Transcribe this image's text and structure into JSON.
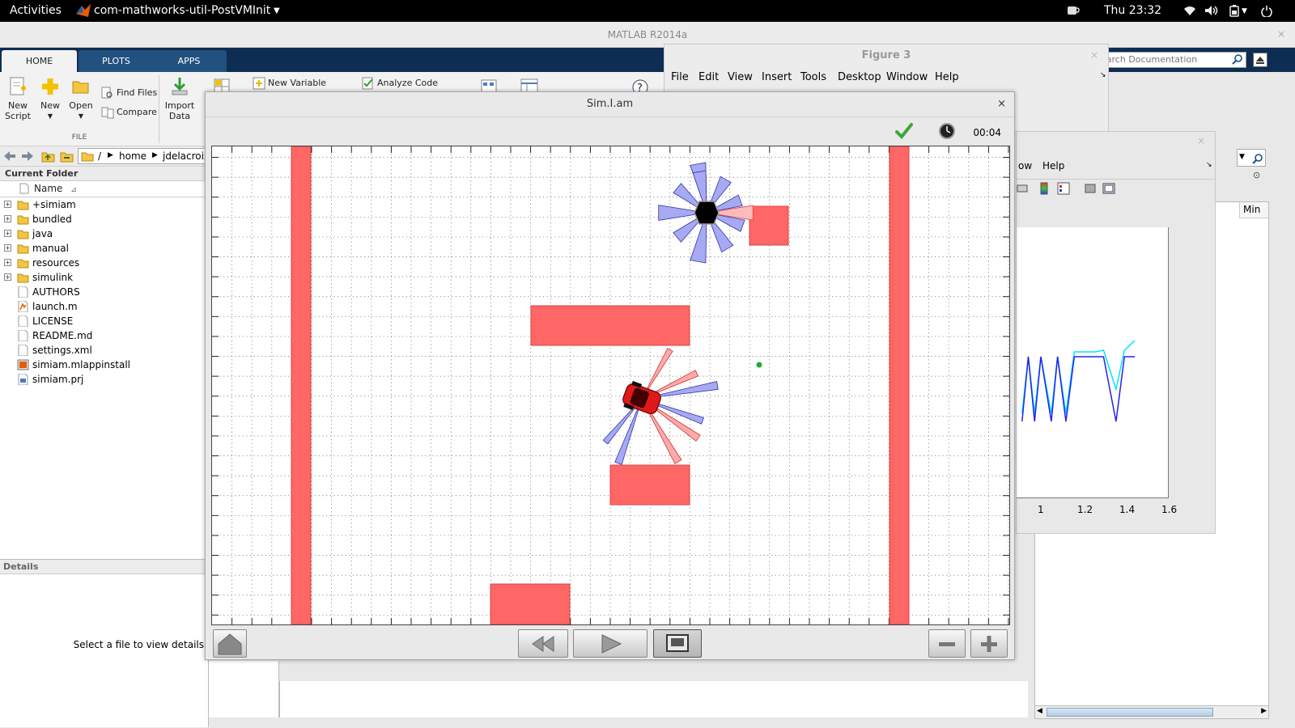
{
  "topbar": {
    "activities": "Activities",
    "app_name": "com-mathworks-util-PostVMInit",
    "clock": "Thu 23:32"
  },
  "matlab": {
    "window_title": "MATLAB R2014a",
    "tabs": [
      {
        "label": "HOME",
        "active": true
      },
      {
        "label": "PLOTS",
        "active": false
      },
      {
        "label": "APPS",
        "active": false
      }
    ],
    "ribbon": {
      "new_script": "New\nScript",
      "new": "New",
      "open": "Open",
      "find_files": "Find Files",
      "compare": "Compare",
      "import_data": "Import\nData",
      "new_variable": "New Variable",
      "analyze_code": "Analyze Code",
      "section_file": "FILE"
    },
    "search_placeholder": "Search Documentation",
    "path": [
      "/",
      "home",
      "jdelacroix"
    ],
    "current_folder": {
      "title": "Current Folder",
      "column_name": "Name",
      "items": [
        {
          "name": "+simiam",
          "type": "folder"
        },
        {
          "name": "bundled",
          "type": "folder"
        },
        {
          "name": "java",
          "type": "folder"
        },
        {
          "name": "manual",
          "type": "folder"
        },
        {
          "name": "resources",
          "type": "folder"
        },
        {
          "name": "simulink",
          "type": "folder"
        },
        {
          "name": "AUTHORS",
          "type": "file"
        },
        {
          "name": "launch.m",
          "type": "mfile"
        },
        {
          "name": "LICENSE",
          "type": "file"
        },
        {
          "name": "README.md",
          "type": "file"
        },
        {
          "name": "settings.xml",
          "type": "file"
        },
        {
          "name": "simiam.mlappinstall",
          "type": "app"
        },
        {
          "name": "simiam.prj",
          "type": "prj"
        }
      ]
    },
    "details": {
      "title": "Details",
      "message": "Select a file to view details"
    },
    "workspace_column": "Min"
  },
  "figure3": {
    "title": "Figure 3",
    "menu": [
      "File",
      "Edit",
      "View",
      "Insert",
      "Tools",
      "Desktop",
      "Window",
      "Help"
    ]
  },
  "figure2": {
    "menu": [
      "ow",
      "Help"
    ],
    "xticks": [
      "1",
      "1.2",
      "1.4",
      "1.6"
    ],
    "series": [
      {
        "color": "#00e5ff",
        "points": [
          [
            0.91,
            0.4
          ],
          [
            0.94,
            0.05
          ],
          [
            0.97,
            0.4
          ],
          [
            1.0,
            0.05
          ],
          [
            1.05,
            0.4
          ],
          [
            1.08,
            0.05
          ],
          [
            1.12,
            0.4
          ],
          [
            1.16,
            0.02
          ],
          [
            1.2,
            0.02
          ],
          [
            1.26,
            0.02
          ],
          [
            1.3,
            0.01
          ],
          [
            1.36,
            0.25
          ],
          [
            1.4,
            0.01
          ],
          [
            1.45,
            -0.05
          ]
        ]
      },
      {
        "color": "#2222ee",
        "points": [
          [
            0.91,
            0.45
          ],
          [
            0.94,
            0.05
          ],
          [
            0.97,
            0.45
          ],
          [
            1.0,
            0.05
          ],
          [
            1.05,
            0.45
          ],
          [
            1.08,
            0.05
          ],
          [
            1.12,
            0.45
          ],
          [
            1.16,
            0.05
          ],
          [
            1.2,
            0.05
          ],
          [
            1.26,
            0.05
          ],
          [
            1.3,
            0.05
          ],
          [
            1.36,
            0.45
          ],
          [
            1.4,
            0.05
          ],
          [
            1.45,
            0.05
          ]
        ]
      }
    ]
  },
  "simiam": {
    "title": "Sim.I.am",
    "close": "×",
    "time": "00:04",
    "obstacle_color": "#ff6666",
    "sensor_color": "#a6aaf2",
    "controls": [
      "home",
      "rewind",
      "play",
      "screenshot",
      "zoom-out",
      "zoom-in"
    ]
  }
}
